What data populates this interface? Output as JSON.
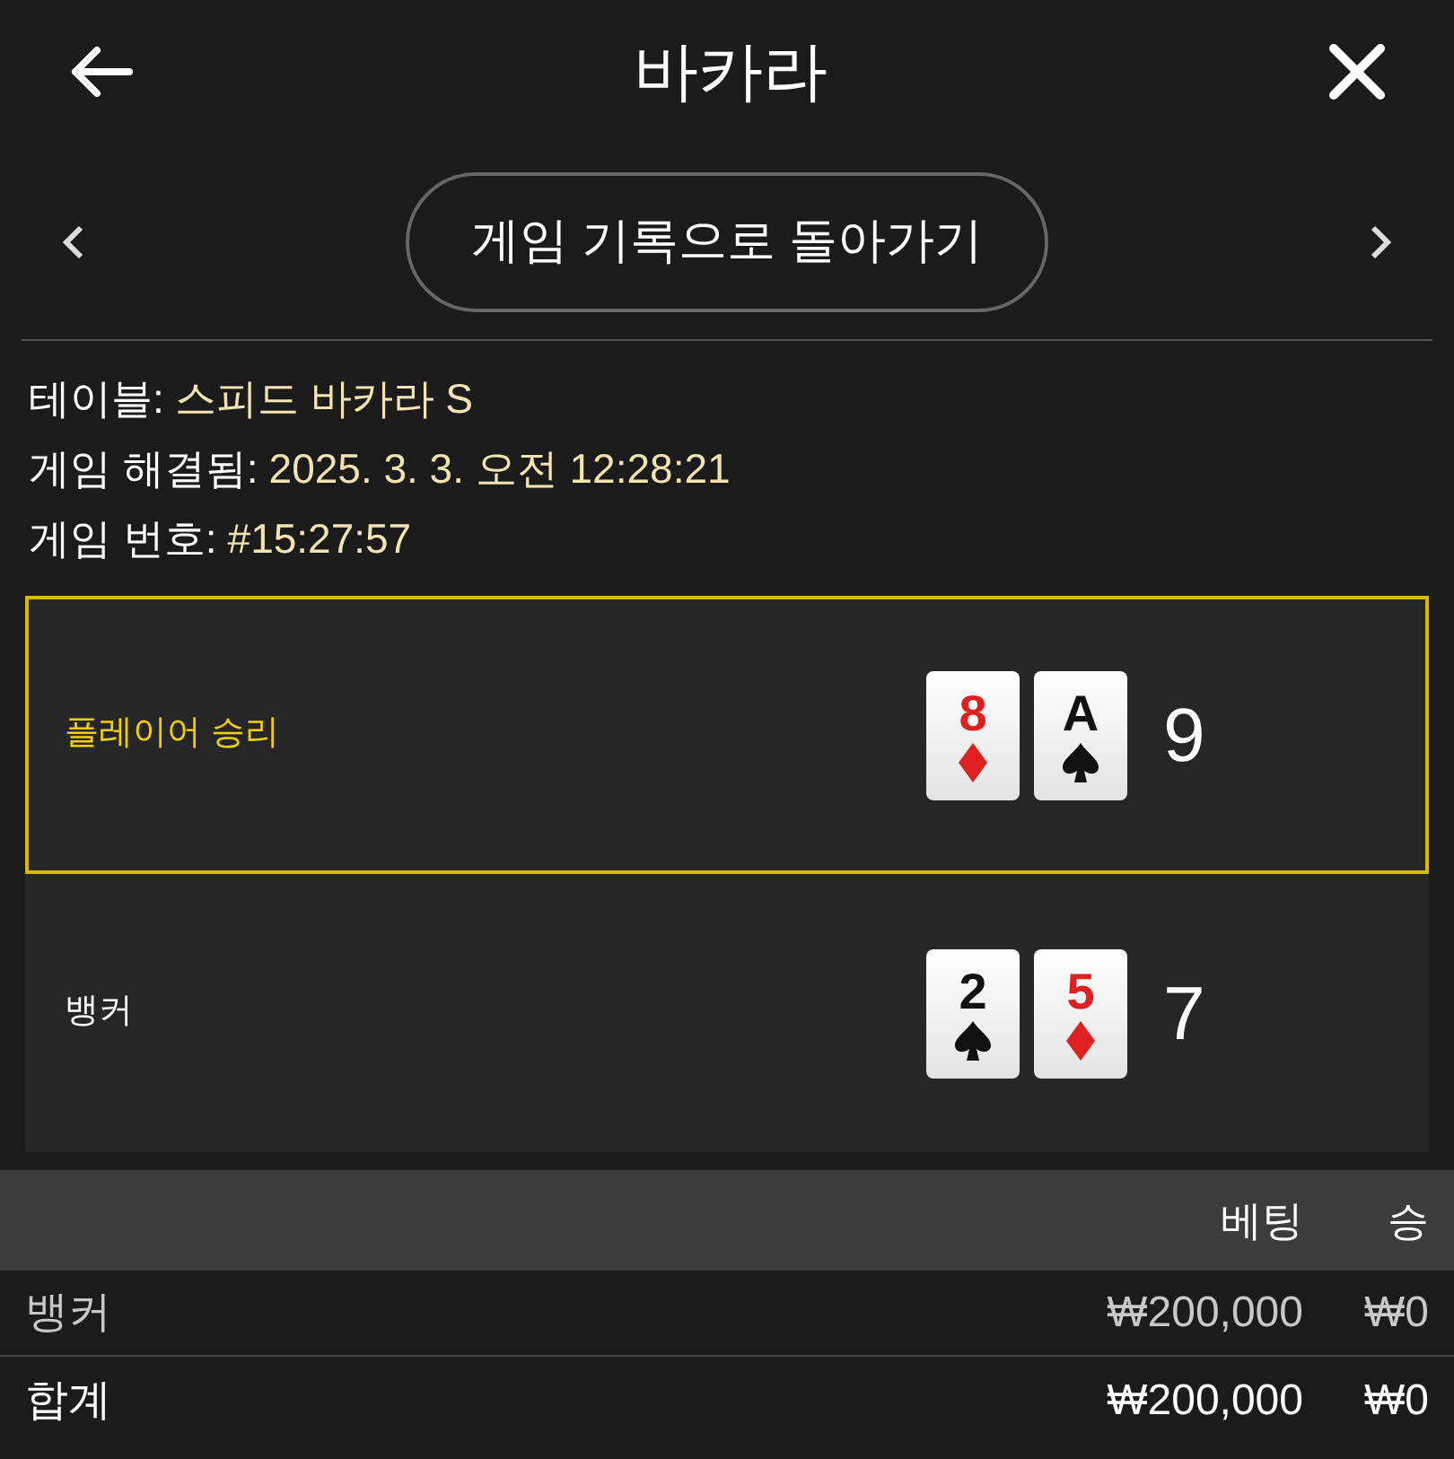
{
  "header": {
    "title": "바카라"
  },
  "nav": {
    "button": "게임 기록으로 돌아가기"
  },
  "info": [
    {
      "label": "테이블:",
      "value": "스피드 바카라 S"
    },
    {
      "label": "게임 해결됨:",
      "value": "2025. 3. 3. 오전 12:28:21"
    },
    {
      "label": "게임 번호:",
      "value": "#15:27:57"
    }
  ],
  "hands": [
    {
      "label": "플레이어 승리",
      "winner": true,
      "cards": [
        {
          "rank": "8",
          "kind": "diamond"
        },
        {
          "rank": "A",
          "kind": "spade"
        }
      ],
      "score": "9"
    },
    {
      "label": "뱅커",
      "winner": false,
      "cards": [
        {
          "rank": "2",
          "kind": "spade"
        },
        {
          "rank": "5",
          "kind": "diamond"
        }
      ],
      "score": "7"
    }
  ],
  "table": {
    "columns": [
      "",
      "베팅",
      "승"
    ],
    "rows": [
      {
        "kind": "bet",
        "cells": [
          "뱅커",
          "₩200,000",
          "₩0"
        ]
      },
      {
        "kind": "total",
        "cells": [
          "합계",
          "₩200,000",
          "₩0"
        ]
      }
    ]
  }
}
